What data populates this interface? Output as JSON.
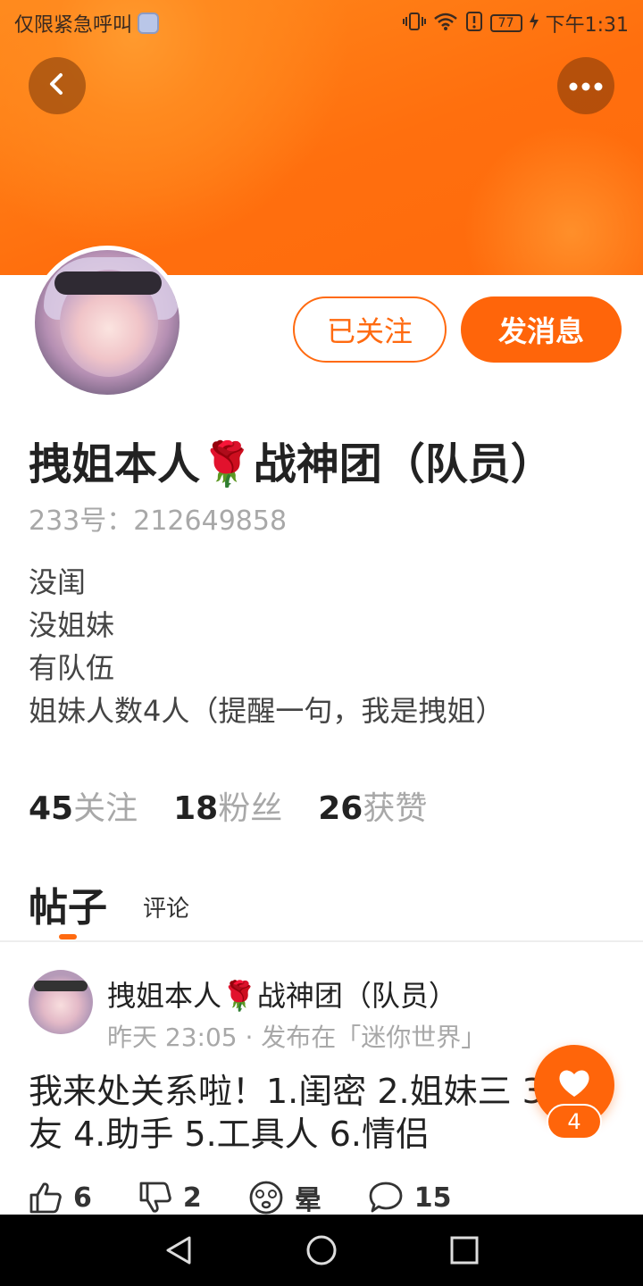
{
  "status_bar": {
    "left_text": "仅限紧急呼叫",
    "time": "下午1:31",
    "battery": "77"
  },
  "profile": {
    "follow_button": "已关注",
    "message_button": "发消息",
    "username": "拽姐本人🌹战神团（队员）",
    "id_line": "233号：212649858",
    "bio": [
      "没闺",
      "没姐妹",
      "有队伍",
      "姐妹人数4人（提醒一句，我是拽姐）"
    ]
  },
  "stats": [
    {
      "count": "45",
      "label": "关注"
    },
    {
      "count": "18",
      "label": "粉丝"
    },
    {
      "count": "26",
      "label": "获赞"
    }
  ],
  "tabs": {
    "posts": "帖子",
    "comments": "评论"
  },
  "post": {
    "author": "拽姐本人🌹战神团（队员）",
    "meta": "昨天 23:05 · 发布在「迷你世界」",
    "body": "我来处关系啦！1.闺密  2.姐妹三 3.朋友 4.助手 5.工具人 6.情侣",
    "like_badge": "4",
    "actions": {
      "like": "6",
      "dislike": "2",
      "dizzy": "晕",
      "comment": "15"
    }
  },
  "colors": {
    "accent": "#ff650a",
    "banner": "#ff7a16"
  },
  "icons": [
    "back-arrow-icon",
    "more-dots-icon",
    "heart-icon",
    "thumbs-up-icon",
    "thumbs-down-icon",
    "dizzy-face-icon",
    "comment-bubble-icon",
    "nav-back-icon",
    "nav-home-icon",
    "nav-recents-icon"
  ]
}
